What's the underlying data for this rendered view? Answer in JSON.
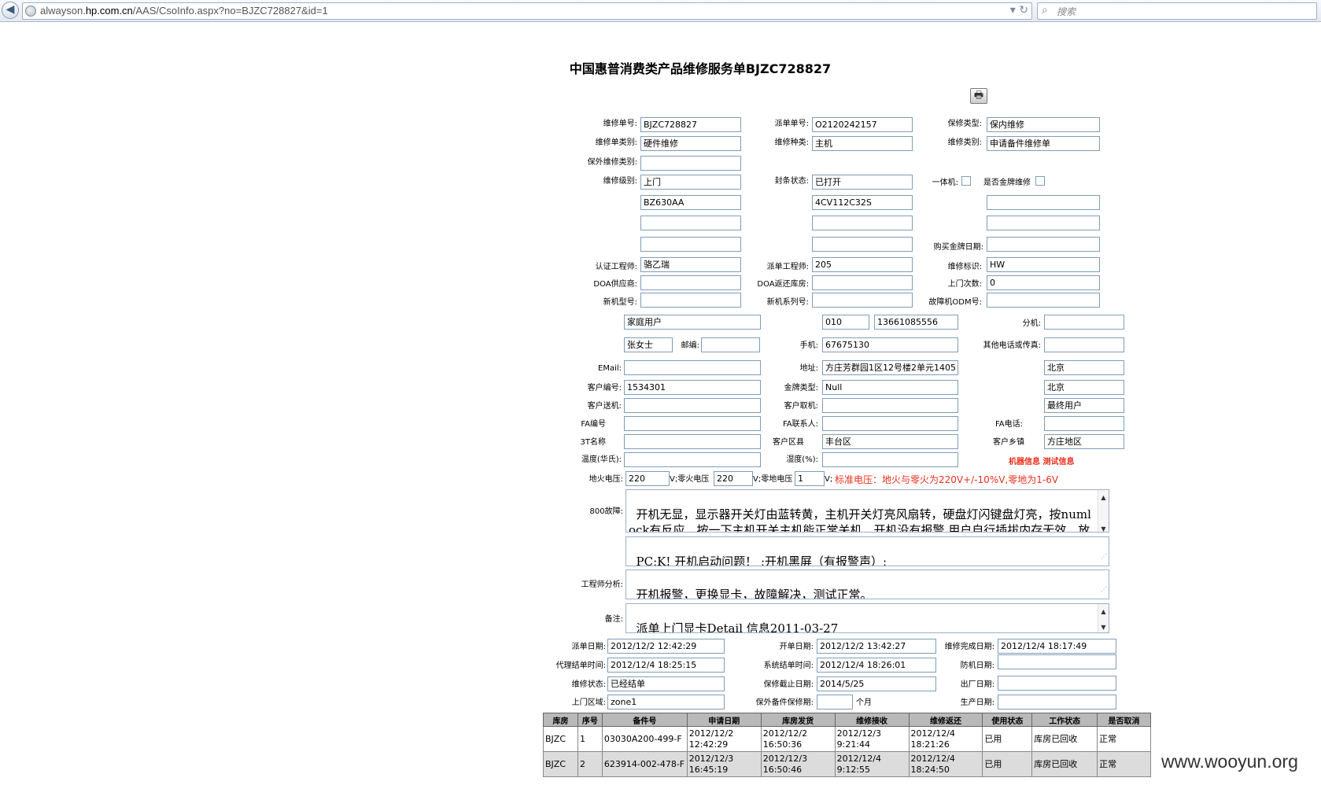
{
  "browser": {
    "url_prefix": "alwayson.",
    "url_domain": "hp.com.cn",
    "url_path": "/AAS/CsoInfo.aspx?no=BJZC728827&id=1",
    "search_placeholder": "搜索"
  },
  "title": "中国惠普消费类产品维修服务单BJZC728827",
  "labels": {
    "repair_no": "维修单号:",
    "dispatch_no": "派单单号:",
    "warranty_type": "保修类型:",
    "repair_category": "维修单类别:",
    "repair_kind": "维修种类:",
    "repair_class": "维修类别:",
    "out_warranty_category": "保外维修类别:",
    "repair_level": "维修级别:",
    "seal_status": "封条状态:",
    "all_in_one": "一体机:",
    "gold_repair": "是否金牌维修",
    "purchase_gold_date": "购买金牌日期:",
    "cert_engineer": "认证工程师:",
    "dispatch_engineer": "派单工程师:",
    "repair_mark": "维修标识:",
    "doa_supplier": "DOA供应商:",
    "doa_return_warehouse": "DOA返还库房:",
    "visit_count": "上门次数:",
    "new_model": "新机型号:",
    "new_serial": "新机系列号:",
    "fault_odm": "故障机ODM号:",
    "ext": "分机:",
    "postcode": "邮编:",
    "mobile": "手机:",
    "other_phone": "其他电话或传真:",
    "email": "EMail:",
    "address": "地址:",
    "customer_no": "客户编号:",
    "gold_type": "金牌类型:",
    "customer_send": "客户送机:",
    "customer_pick": "客户取机:",
    "fa_no": "FA编号",
    "fa_contact": "FA联系人:",
    "fa_phone": "FA电话:",
    "3t_name": "3T名称",
    "customer_district": "客户区县",
    "customer_town": "客户乡镇",
    "temperature": "温度(华氏):",
    "humidity": "湿度(%):",
    "machine_info": "机器信息 测试信息",
    "live_ground_v": "地火电压:",
    "v_live_neutral": "V;零火电压",
    "v_neutral_ground": "V;零地电压",
    "v_end": "V;",
    "voltage_note": "标准电压：地火与零火为220V+/-10%V,零地为1-6V",
    "fault_800": "800故障:",
    "engineer_analysis": "工程师分析:",
    "remark": "备注:",
    "dispatch_date": "派单日期:",
    "open_date": "开单日期:",
    "repair_done_date": "维修完成日期:",
    "agent_close_time": "代理结单时间:",
    "system_close_time": "系统结单时间:",
    "return_date": "防机日期:",
    "repair_status": "维修状态:",
    "warranty_end_date": "保修截止日期:",
    "factory_date": "出厂日期:",
    "visit_area": "上门区域:",
    "out_warranty_parts": "保外备件保修期:",
    "months": "个月",
    "production_date": "生产日期:"
  },
  "values": {
    "repair_no": "BJZC728827",
    "dispatch_no": "O2120242157",
    "warranty_type": "保内维修",
    "repair_category": "硬件维修",
    "repair_kind": "主机",
    "repair_class": "申请备件维修单",
    "out_warranty_category": "",
    "repair_level": "上门",
    "seal_status": "已打开",
    "product_no": "BZ630AA",
    "serial_no": "4CV112C32S",
    "cert_engineer": "骆乙瑞",
    "dispatch_engineer": "205",
    "repair_mark": "HW",
    "visit_count": "0",
    "customer_type": "家庭用户",
    "area_code": "010",
    "phone": "13661085556",
    "contact_name": "张女士",
    "mobile": "67675130",
    "address": "方庄芳群园1区12号楼2单元1405",
    "province": "北京",
    "customer_no": "1534301",
    "gold_type": "Null",
    "city": "北京",
    "user_type": "最终用户",
    "customer_district": "丰台区",
    "customer_town": "方庄地区",
    "live_ground_v": "220",
    "live_neutral_v": "220",
    "neutral_ground_v": "1",
    "fault_800": "开机无显，显示器开关灯由蓝转黄，主机开关灯亮风扇转，硬盘灯闪键盘灯亮，按numlock有反应，按一下主机开关主机能正常关机，开机没有报警.用户自行插拔内存无效，放电也无效。",
    "fault_code": "PC;K! 开机启动问题！ ;开机黑屏（有报警声）;",
    "engineer_analysis": "开机报警，更换显卡，故障解决，测试正常。",
    "remark": "派单上门显卡Detail 信息2011-03-27\n上门前电话联系产品购买日期。",
    "dispatch_date": "2012/12/2 12:42:29",
    "open_date": "2012/12/2 13:42:27",
    "repair_done_date": "2012/12/4 18:17:49",
    "agent_close_time": "2012/12/4 18:25:15",
    "system_close_time": "2012/12/4 18:26:01",
    "repair_status": "已经结单",
    "warranty_end_date": "2014/5/25",
    "visit_area": "zone1"
  },
  "table": {
    "headers": [
      "库房",
      "序号",
      "备件号",
      "申请日期",
      "库房发货",
      "维修接收",
      "维修返还",
      "使用状态",
      "工作状态",
      "是否取消"
    ],
    "rows": [
      [
        "BJZC",
        "1",
        "03030A200-499-F",
        "2012/12/2 12:42:29",
        "2012/12/2 16:50:36",
        "2012/12/3 9:21:44",
        "2012/12/4 18:21:26",
        "已用",
        "库房已回收",
        "正常"
      ],
      [
        "BJZC",
        "2",
        "623914-002-478-F",
        "2012/12/3 16:45:19",
        "2012/12/3 16:50:46",
        "2012/12/4 9:12:55",
        "2012/12/4 18:24:50",
        "已用",
        "库房已回收",
        "正常"
      ]
    ]
  },
  "watermark": "www.wooyun.org"
}
